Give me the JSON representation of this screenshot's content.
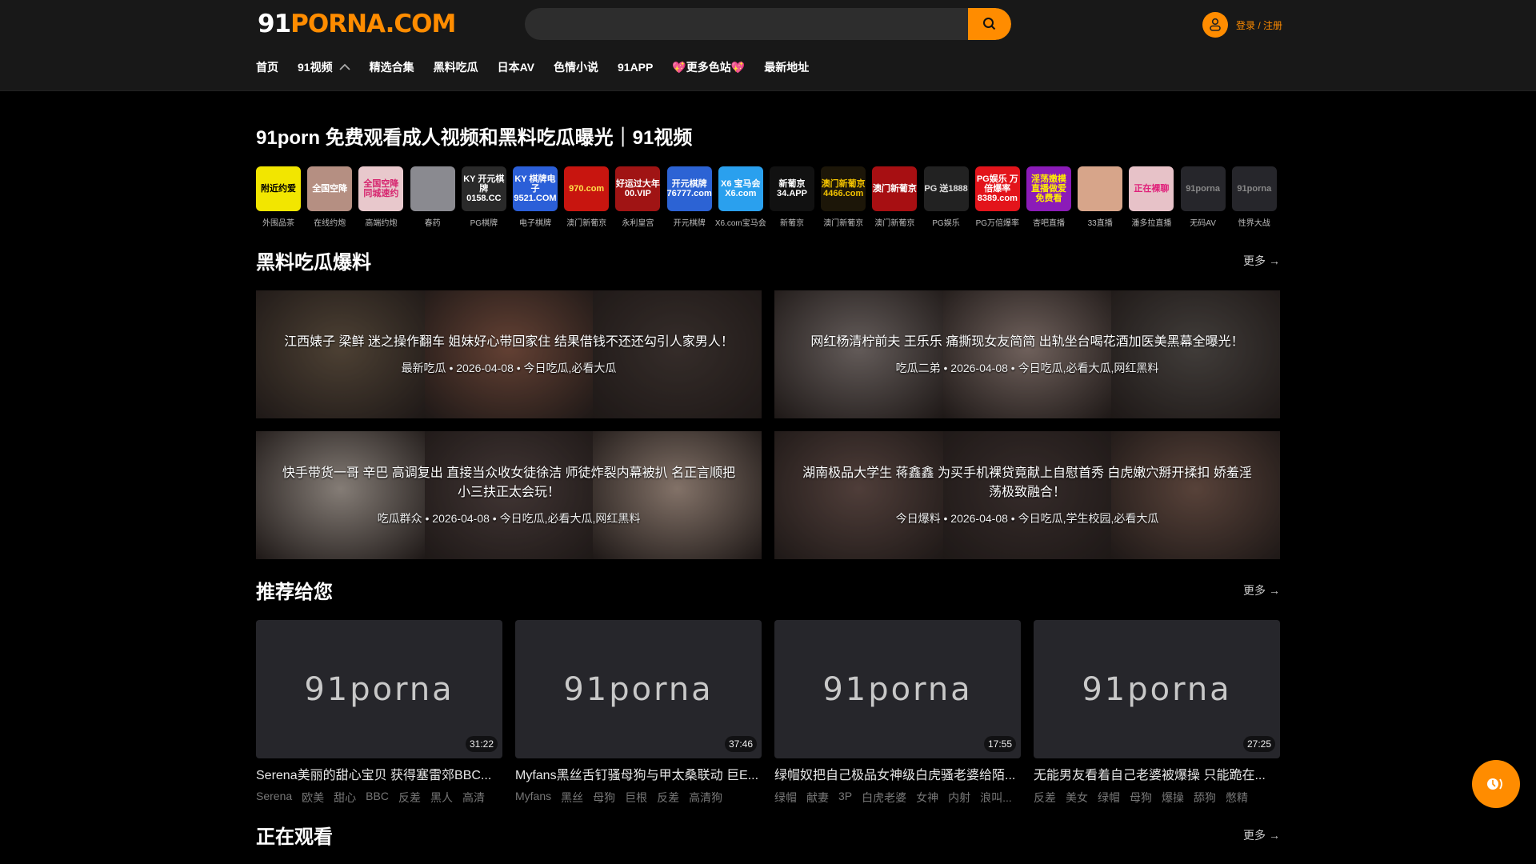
{
  "header": {
    "logo_num": "91",
    "logo_text": "PORNA.COM",
    "search_placeholder": "",
    "login_label": "登录 / 注册"
  },
  "nav": [
    "首页",
    "91视频",
    "精选合集",
    "黑料吃瓜",
    "日本AV",
    "色情小说",
    "91APP",
    "💖更多色站💖",
    "最新地址"
  ],
  "page_title": "91porn 免费观看成人视频和黑料吃瓜曝光｜91视频",
  "icons": [
    {
      "label": "外围品茶",
      "art": "附近约爱",
      "bg": "#f2e600",
      "fg": "#000"
    },
    {
      "label": "在线约炮",
      "art": "全国空降",
      "bg": "#b58f82",
      "fg": "#fff"
    },
    {
      "label": "高端约炮",
      "art": "全国空降 同城速约",
      "bg": "#e8c8cc",
      "fg": "#d6246e"
    },
    {
      "label": "春药",
      "art": "",
      "bg": "#8a8a90",
      "fg": "#fff"
    },
    {
      "label": "PG棋牌",
      "art": "KY 开元棋牌 0158.CC",
      "bg": "#2a2a2a",
      "fg": "#fff"
    },
    {
      "label": "电子棋牌",
      "art": "KY 棋牌电子 9521.COM",
      "bg": "#2b5fd8",
      "fg": "#fff"
    },
    {
      "label": "澳门新葡京",
      "art": "970.com",
      "bg": "#c8150f",
      "fg": "#ffe04a"
    },
    {
      "label": "永利皇宫",
      "art": "好运过大年 00.VIP",
      "bg": "#a01414",
      "fg": "#fff"
    },
    {
      "label": "开元棋牌",
      "art": "开元棋牌 76777.com",
      "bg": "#2c63d4",
      "fg": "#fff"
    },
    {
      "label": "X6.com宝马会",
      "art": "X6 宝马会 X6.com",
      "bg": "#2aa0ee",
      "fg": "#fff"
    },
    {
      "label": "新葡京",
      "art": "新葡京 34.APP",
      "bg": "#111",
      "fg": "#fff"
    },
    {
      "label": "澳门新葡京",
      "art": "澳门新葡京 4466.com",
      "bg": "#1c1608",
      "fg": "#f2c200"
    },
    {
      "label": "澳门新葡京",
      "art": "澳门新葡京",
      "bg": "#a70f12",
      "fg": "#fff"
    },
    {
      "label": "PG娱乐",
      "art": "PG 送1888",
      "bg": "#222",
      "fg": "#ddd"
    },
    {
      "label": "PG万倍爆率",
      "art": "PG娱乐 万倍爆率 8389.com",
      "bg": "#e3141b",
      "fg": "#fff"
    },
    {
      "label": "杏吧直播",
      "art": "淫荡嫩模 直播做爱 免费看",
      "bg": "#8b1bb8",
      "fg": "#ffee00"
    },
    {
      "label": "33直播",
      "art": "",
      "bg": "#d7a58a",
      "fg": "#fff"
    },
    {
      "label": "潘多拉直播",
      "art": "正在裸聊",
      "bg": "#e7c2c8",
      "fg": "#e0207a"
    },
    {
      "label": "无码AV",
      "art": "91porna",
      "bg": "#26262b",
      "fg": "#888"
    },
    {
      "label": "性界大战",
      "art": "91porna",
      "bg": "#26262b",
      "fg": "#888"
    }
  ],
  "sections": {
    "gossip": "黑料吃瓜爆料",
    "recommend": "推荐给您",
    "watching": "正在观看",
    "more": "更多"
  },
  "gossip": [
    {
      "title": "江西婊子 梁鲜 迷之操作翻车 姐妹好心带回家住 结果借钱不还还勾引人家男人！",
      "meta": "最新吃瓜 • 2026-04-08 • 今日吃瓜,必看大瓜",
      "colors": [
        "#6b5a48",
        "#8a5a48",
        "#4a3e3a"
      ]
    },
    {
      "title": "网红杨清柠前夫 王乐乐 痛撕现女友简简 出轨坐台喝花酒加医美黑幕全曝光！",
      "meta": "吃瓜二弟 • 2026-04-08 • 今日吃瓜,必看大瓜,网红黑料",
      "colors": [
        "#8a7f7c",
        "#9b8780",
        "#5a5450"
      ]
    },
    {
      "title": "快手带货一哥 辛巴 高调复出 直接当众收女徒徐洁 师徒炸裂内幕被扒 名正言顺把小三扶正太会玩！",
      "meta": "吃瓜群众 • 2026-04-08 • 今日吃瓜,必看大瓜,网红黑料",
      "colors": [
        "#b8ada4",
        "#5a4a48",
        "#b59e90"
      ]
    },
    {
      "title": "湖南极品大学生 蒋鑫鑫 为买手机裸贷竟献上自慰首秀 白虎嫩穴掰开揉扣 娇羞淫荡极致融合！",
      "meta": "今日爆料 • 2026-04-08 • 今日吃瓜,学生校园,必看大瓜",
      "colors": [
        "#6e5650",
        "#4a3c3a",
        "#7a5c50"
      ]
    }
  ],
  "videos": [
    {
      "watermark": "91porna",
      "duration": "31:22",
      "title": "Serena美丽的甜心宝贝 获得塞雷郊BBC...",
      "tags": [
        "Serena",
        "欧美",
        "甜心",
        "BBC",
        "反差",
        "黑人",
        "高清"
      ]
    },
    {
      "watermark": "91porna",
      "duration": "37:46",
      "title": "Myfans黑丝舌钉骚母狗与甲太桑联动 巨E...",
      "tags": [
        "Myfans",
        "黑丝",
        "母狗",
        "巨根",
        "反差",
        "高清狗"
      ]
    },
    {
      "watermark": "91porna",
      "duration": "17:55",
      "title": "绿帽奴把自己极品女神级白虎骚老婆给陌...",
      "tags": [
        "绿帽",
        "献妻",
        "3P",
        "白虎老婆",
        "女神",
        "内射",
        "浪叫..."
      ]
    },
    {
      "watermark": "91porna",
      "duration": "27:25",
      "title": "无能男友看着自己老婆被爆操 只能跪在...",
      "tags": [
        "反差",
        "美女",
        "绿帽",
        "母狗",
        "爆操",
        "舔狗",
        "憋精"
      ]
    }
  ],
  "accent": "#ff8c00"
}
